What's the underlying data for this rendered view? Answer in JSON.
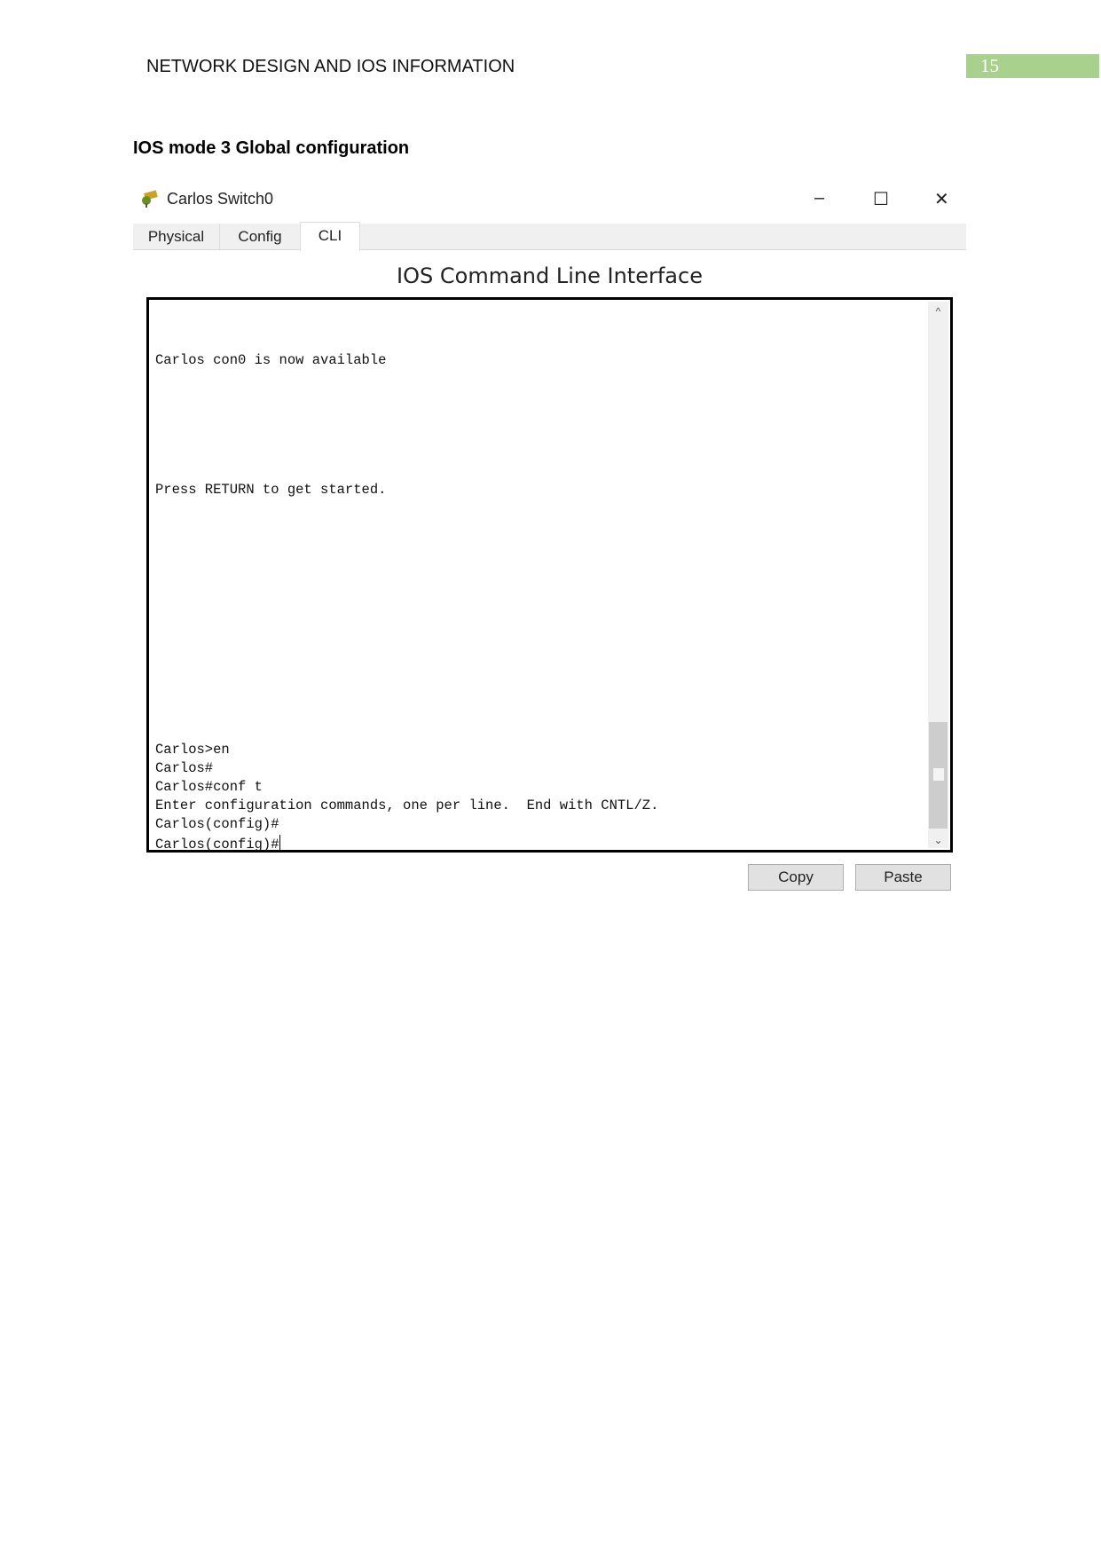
{
  "header": {
    "title": "NETWORK DESIGN AND IOS INFORMATION",
    "page_number": "15",
    "page_badge_color": "#a9d18e"
  },
  "heading": "IOS mode 3 Global configuration",
  "window": {
    "title": "Carlos Switch0",
    "app_icon": "packet-tracer-switch-icon",
    "controls": {
      "minimize": "–",
      "maximize": "☐",
      "close": "✕"
    },
    "tabs": [
      {
        "label": "Physical"
      },
      {
        "label": "Config"
      },
      {
        "label": "CLI",
        "active": true
      }
    ],
    "cli_title": "IOS Command Line Interface",
    "terminal_lines": [
      "Carlos con0 is now available",
      "Press RETURN to get started.",
      "Carlos>en",
      "Carlos#",
      "Carlos#conf t",
      "Enter configuration commands, one per line.  End with CNTL/Z.",
      "Carlos(config)#",
      "Carlos(config)#"
    ],
    "buttons": {
      "copy": "Copy",
      "paste": "Paste"
    }
  }
}
